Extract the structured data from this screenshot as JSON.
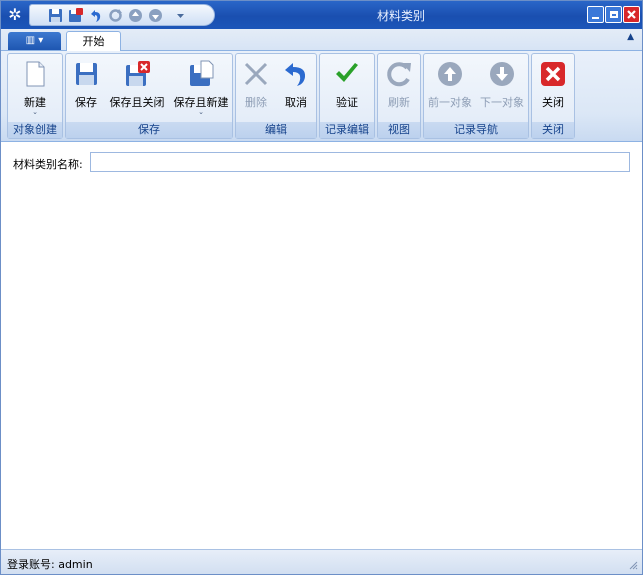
{
  "window": {
    "title": "材料类别"
  },
  "quick_access": {
    "icons": [
      "save-icon",
      "save-close-icon",
      "undo-icon",
      "refresh-icon",
      "up-icon",
      "down-icon",
      "customize-icon"
    ]
  },
  "ribbon": {
    "tab_label": "开始",
    "groups": {
      "create": {
        "label": "对象创建",
        "new_label": "新建"
      },
      "save": {
        "label": "保存",
        "save_label": "保存",
        "save_close_label": "保存且关闭",
        "save_new_label": "保存且新建"
      },
      "edit": {
        "label": "编辑",
        "delete_label": "删除",
        "cancel_label": "取消"
      },
      "record_edit": {
        "label": "记录编辑",
        "validate_label": "验证"
      },
      "view": {
        "label": "视图",
        "refresh_label": "刷新"
      },
      "nav": {
        "label": "记录导航",
        "prev_label": "前一对象",
        "next_label": "下一对象"
      },
      "close": {
        "label": "关闭",
        "close_label": "关闭"
      }
    }
  },
  "form": {
    "category_name_label": "材料类别名称:",
    "category_name_value": ""
  },
  "status": {
    "login_text": "登录账号: admin"
  },
  "colors": {
    "titlebar": "#1c56b9",
    "ribbon_text": "#15428b",
    "disabled_text": "#8d9db5",
    "validate_green": "#2aa12a",
    "close_red": "#d8282a"
  }
}
